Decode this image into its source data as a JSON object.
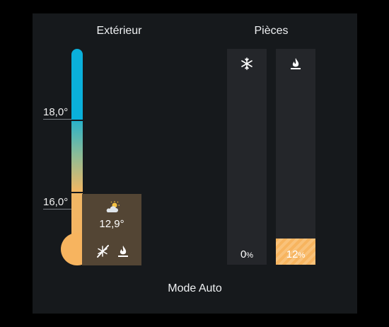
{
  "exterior": {
    "title": "Extérieur",
    "ticks": [
      {
        "label": "18,0°"
      },
      {
        "label": "16,0°"
      }
    ],
    "weather": {
      "icon": "partly-sunny-icon",
      "temperature": "12,9°"
    },
    "status_icons": [
      "no-cooling-icon",
      "flame-icon"
    ]
  },
  "rooms": {
    "title": "Pièces",
    "cooling": {
      "icon": "snowflake-icon",
      "value": "0",
      "unit": "%",
      "level": 0
    },
    "heating": {
      "icon": "flame-icon",
      "value": "12",
      "unit": "%",
      "level": 0.12
    }
  },
  "mode": {
    "label": "Mode Auto"
  },
  "colors": {
    "background": "#16191c",
    "cool": "#0ab0db",
    "heat": "#f7b45f",
    "weather_box": "#534534",
    "bar_track": "#24262a"
  }
}
